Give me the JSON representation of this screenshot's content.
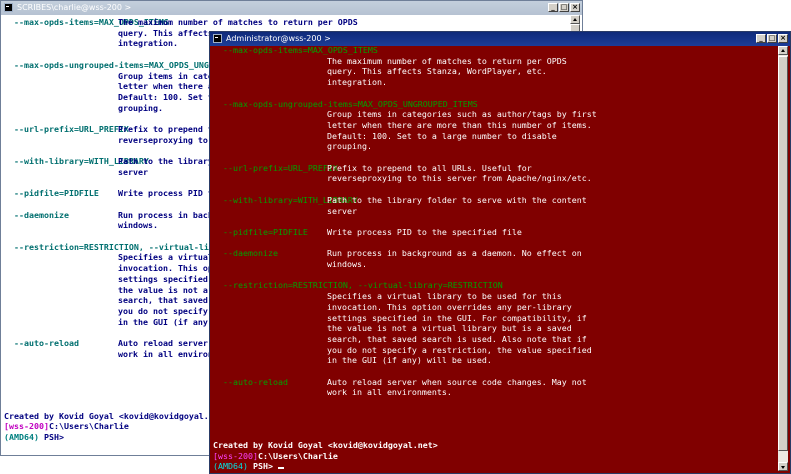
{
  "back_window": {
    "title": "SCRIBES\\charlie@wss-200 >",
    "options": [
      {
        "name": "--max-opds-items=MAX_OPDS_ITEMS",
        "desc": [
          "The maximum number of matches to return per OPDS",
          "query. This affects",
          "integration."
        ]
      },
      {
        "name": "--max-opds-ungrouped-items=MAX_OPDS_UNGRO",
        "desc": [
          "Group items in cate",
          "letter when there a",
          "Default: 100. Set t",
          "grouping."
        ]
      },
      {
        "name": "--url-prefix=URL_PREFIX",
        "desc": [
          "Prefix to prepend t",
          "reverseproxying to"
        ]
      },
      {
        "name": "--with-library=WITH_LIBRARY",
        "desc": [
          "Path to the library",
          "server"
        ]
      },
      {
        "name": "--pidfile=PIDFILE",
        "desc": [
          "Write process PID t"
        ]
      },
      {
        "name": "--daemonize",
        "desc": [
          "Run process in back",
          "windows."
        ]
      },
      {
        "name": "--restriction=RESTRICTION, --virtual-libr",
        "desc": [
          "Specifies a virtual",
          "invocation. This op",
          "settings specified",
          "the value is not a",
          "search, that saved",
          "you do not specify",
          "in the GUI (if any)"
        ]
      },
      {
        "name": "--auto-reload",
        "desc": [
          "Auto reload server",
          "work in all environ"
        ]
      }
    ],
    "author_line": "Created by Kovid Goyal <kovid@kovidgoyal.net>",
    "prompt_host": "[wss-200]",
    "prompt_path": "C:\\Users\\Charlie",
    "prompt_arch": "(AMD64)",
    "prompt_shell": "PSH>"
  },
  "front_window": {
    "title": "Administrator@wss-200 >",
    "options": [
      {
        "name": "--max-opds-items=MAX_OPDS_ITEMS",
        "desc": [
          "The maximum number of matches to return per OPDS",
          "query. This affects Stanza, WordPlayer, etc.",
          "integration."
        ]
      },
      {
        "name": "--max-opds-ungrouped-items=MAX_OPDS_UNGROUPED_ITEMS",
        "desc": [
          "Group items in categories such as author/tags by first",
          "letter when there are more than this number of items.",
          "Default: 100. Set to a large number to disable",
          "grouping."
        ]
      },
      {
        "name": "--url-prefix=URL_PREFIX",
        "desc": [
          "Prefix to prepend to all URLs. Useful for",
          "reverseproxying to this server from Apache/nginx/etc."
        ]
      },
      {
        "name": "--with-library=WITH_LIBRARY",
        "desc": [
          "Path to the library folder to serve with the content",
          "server"
        ]
      },
      {
        "name": "--pidfile=PIDFILE",
        "desc": [
          "Write process PID to the specified file"
        ]
      },
      {
        "name": "--daemonize",
        "desc": [
          "Run process in background as a daemon. No effect on",
          "windows."
        ]
      },
      {
        "name": "--restriction=RESTRICTION, --virtual-library=RESTRICTION",
        "desc": [
          "Specifies a virtual library to be used for this",
          "invocation. This option overrides any per-library",
          "settings specified in the GUI. For compatibility, if",
          "the value is not a virtual library but is a saved",
          "search, that saved search is used. Also note that if",
          "you do not specify a restriction, the value specified",
          "in the GUI (if any) will be used."
        ]
      },
      {
        "name": "--auto-reload",
        "desc": [
          "Auto reload server when source code changes. May not",
          "work in all environments."
        ]
      }
    ],
    "author_line": "Created by Kovid Goyal <kovid@kovidgoyal.net>",
    "prompt_host": "[wss-200]",
    "prompt_path": "C:\\Users\\Charlie",
    "prompt_arch": "(AMD64)",
    "prompt_shell": "PSH>"
  },
  "colors": {
    "admin_background": "#800000",
    "option_green": "#00a000",
    "prompt_magenta": "#c000c0"
  },
  "icons": [
    "console-icon",
    "minimize-icon",
    "maximize-icon",
    "close-icon",
    "scroll-up-icon",
    "scroll-down-icon"
  ]
}
